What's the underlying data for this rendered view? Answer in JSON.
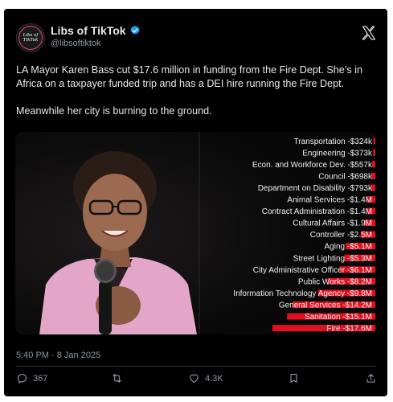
{
  "author": {
    "display_name": "Libs of TikTok",
    "handle": "@libsoftiktok",
    "avatar_text": [
      "Libs of",
      "TikTok"
    ]
  },
  "tweet": {
    "paragraphs": [
      "LA Mayor Karen Bass cut $17.6 million in funding from the Fire Dept. She’s in Africa on a taxpayer funded trip and has a DEI hire running the Fire Dept.",
      "Meanwhile her city is burning to the ground."
    ],
    "timestamp": "5:40 PM · 8 Jan 2025"
  },
  "actions": {
    "replies": "367",
    "reposts": "",
    "likes": "4.3K"
  },
  "icons": [
    "verified-badge-icon",
    "x-logo-icon",
    "reply-icon",
    "repost-icon",
    "like-icon",
    "bookmark-icon",
    "share-icon"
  ],
  "colors": {
    "verified": "#1d9bf0",
    "bar": "#e01020",
    "text": "#e7e9ea",
    "muted": "#8b98a5"
  },
  "chart_data": {
    "type": "bar",
    "orientation": "horizontal",
    "categories": [
      "Transportation",
      "Engineering",
      "Econ. and Workforce Dev.",
      "Council",
      "Department on Disability",
      "Animal Services",
      "Contract Administration",
      "Cultural Affairs",
      "Controller",
      "Aging",
      "Street Lighting",
      "City Administrative Officer",
      "Public Works",
      "Information Technology Agency",
      "General Services",
      "Sanitation",
      "Fire"
    ],
    "labels": [
      "Transportation -$324k",
      "Engineering -$373k",
      "Econ. and Workforce Dev. -$557k",
      "Council -$698k",
      "Department on Disability -$793k",
      "Animal Services -$1.4M",
      "Contract Administration -$1.4M",
      "Cultural Affairs -$1.9M",
      "Controller -$2.5M",
      "Aging -$5.1M",
      "Street Lighting -$5.3M",
      "City Administrative Officer -$6.1M",
      "Public Works -$8.2M",
      "Information Technology Agency -$9.8M",
      "General Services -$14.2M",
      "Sanitation -$15.1M",
      "Fire -$17.6M"
    ],
    "values": [
      -0.324,
      -0.373,
      -0.557,
      -0.698,
      -0.793,
      -1.4,
      -1.4,
      -1.9,
      -2.5,
      -5.1,
      -5.3,
      -6.1,
      -8.2,
      -9.8,
      -14.2,
      -15.1,
      -17.6
    ],
    "unit": "millions USD",
    "title": "",
    "xlabel": "",
    "ylabel": ""
  }
}
